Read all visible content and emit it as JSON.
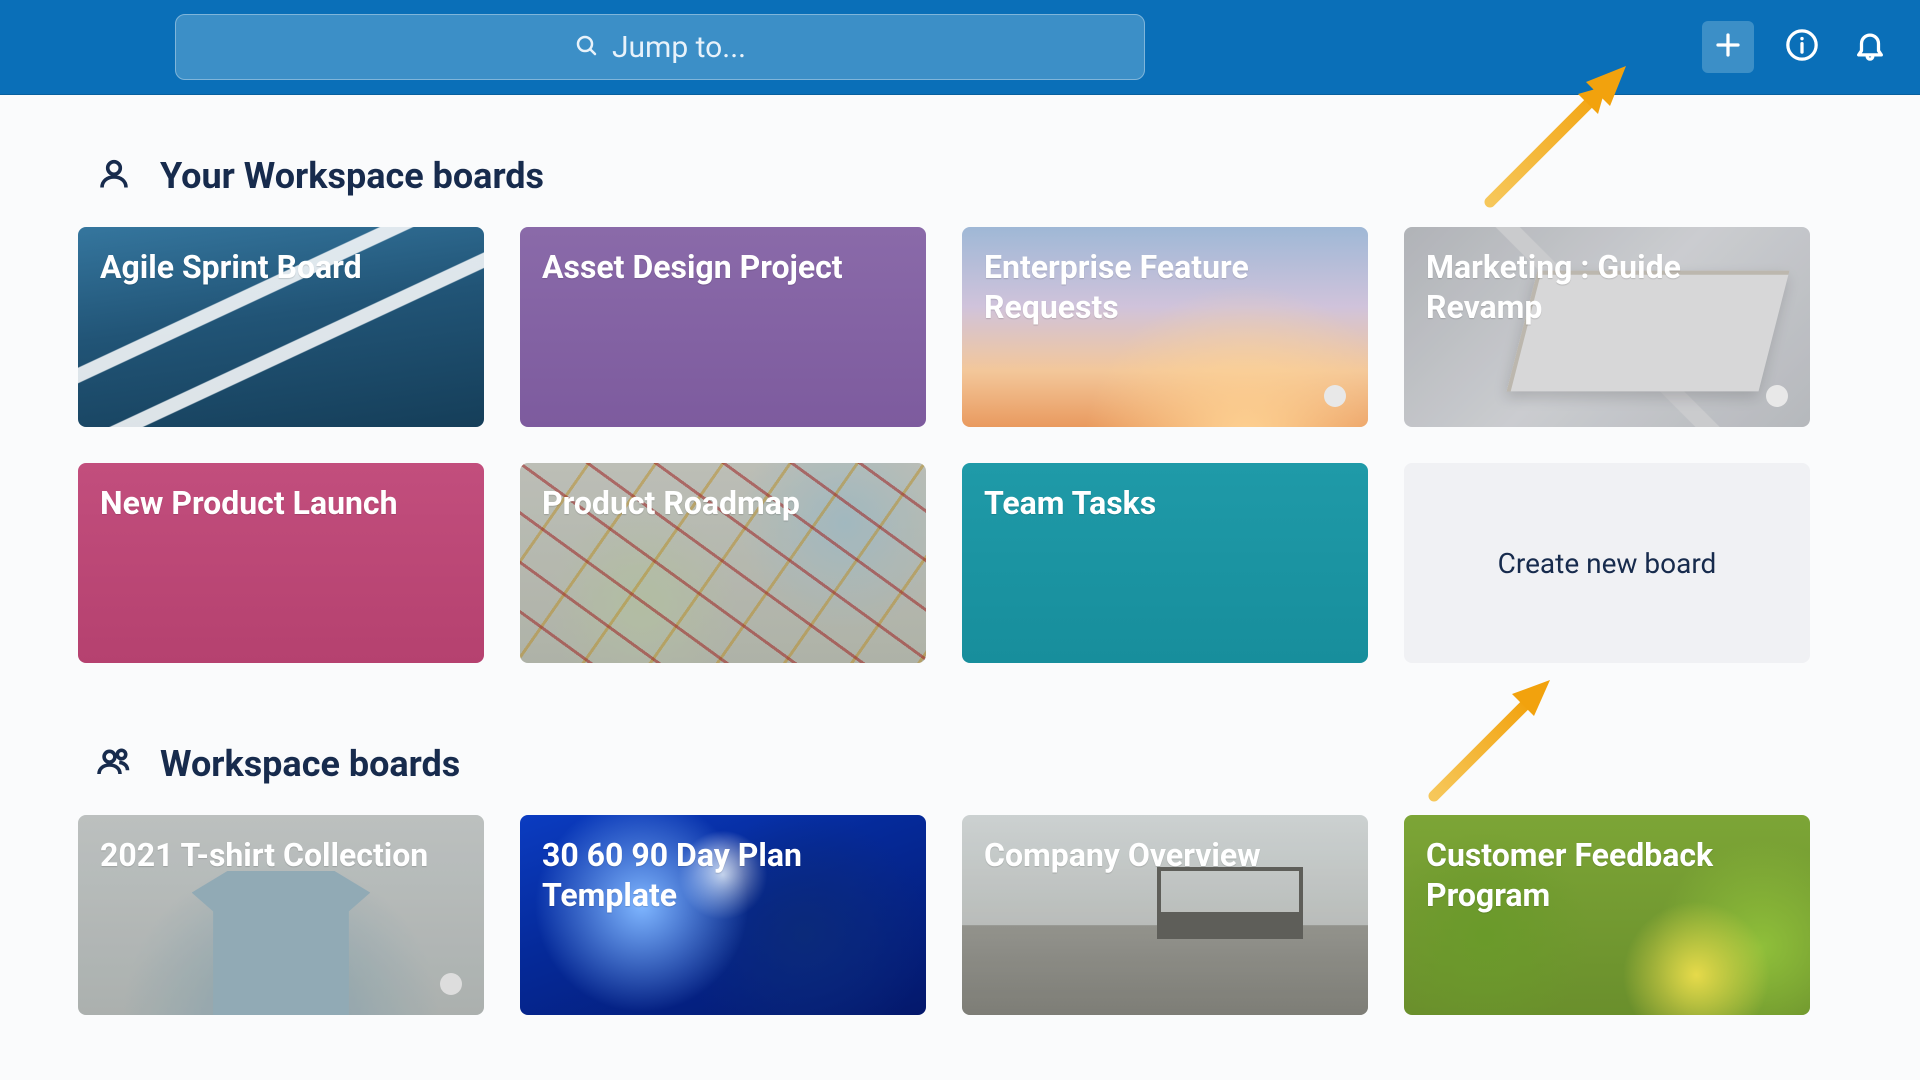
{
  "header": {
    "search_placeholder": "Jump to..."
  },
  "sections": {
    "your_boards_title": "Your Workspace boards",
    "workspace_boards_title": "Workspace boards",
    "create_new_board_label": "Create new board"
  },
  "your_boards": [
    {
      "title": "Agile Sprint Board"
    },
    {
      "title": "Asset Design Project"
    },
    {
      "title": "Enterprise Feature Requests"
    },
    {
      "title": "Marketing : Guide Revamp"
    },
    {
      "title": "New Product Launch"
    },
    {
      "title": "Product Roadmap"
    },
    {
      "title": "Team Tasks"
    }
  ],
  "workspace_boards": [
    {
      "title": "2021 T-shirt Collection"
    },
    {
      "title": "30 60 90 Day Plan Template"
    },
    {
      "title": "Company Overview"
    },
    {
      "title": "Customer Feedback Program"
    }
  ]
}
